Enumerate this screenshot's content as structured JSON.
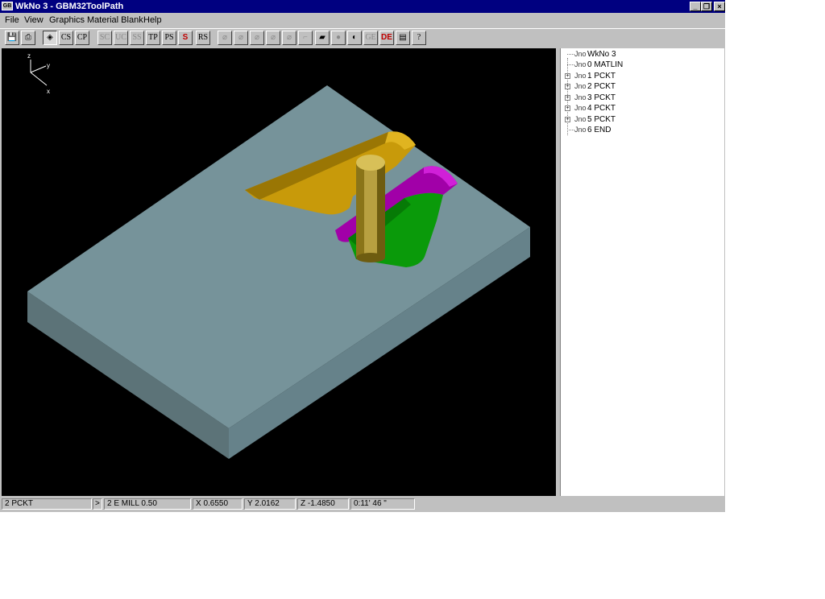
{
  "window": {
    "title": "WkNo 3 - GBM32ToolPath",
    "app_icon": "GB"
  },
  "caption_buttons": {
    "minimize": "_",
    "restore": "❐",
    "close": "×"
  },
  "menu": [
    {
      "label": "File"
    },
    {
      "label": "View"
    },
    {
      "label": "Graphics"
    },
    {
      "label": "Material Blank"
    },
    {
      "label": "Help"
    }
  ],
  "toolbar": {
    "buttons": [
      {
        "label": "💾",
        "icon": "save-icon"
      },
      {
        "label": "⎙",
        "icon": "print-icon"
      },
      {
        "label": "◈",
        "icon": "solid-view-icon"
      },
      {
        "label": "CS"
      },
      {
        "label": "CP"
      },
      {
        "label": "SC"
      },
      {
        "label": "UC"
      },
      {
        "label": "SS"
      },
      {
        "label": "TP"
      },
      {
        "label": "PS"
      },
      {
        "label": "S"
      },
      {
        "label": "RS"
      },
      {
        "label": "⌀",
        "icon": "view-iso-icon"
      },
      {
        "label": "⌀",
        "icon": "view-top-icon"
      },
      {
        "label": "⌀",
        "icon": "view-front-icon"
      },
      {
        "label": "⌀",
        "icon": "view-side-icon"
      },
      {
        "label": "⌀",
        "icon": "view-rotate-icon"
      },
      {
        "label": "⌐",
        "icon": "axis-icon"
      },
      {
        "label": "▰",
        "icon": "block-icon"
      },
      {
        "label": "●",
        "icon": "sphere-icon"
      },
      {
        "label": "◐",
        "icon": "shade-icon"
      },
      {
        "label": "GE"
      },
      {
        "label": "DE"
      },
      {
        "label": "▤",
        "icon": "list-icon"
      },
      {
        "label": "?",
        "icon": "help-icon"
      }
    ]
  },
  "axes": {
    "z": "z",
    "y": "y",
    "x": "x"
  },
  "tree": {
    "nodes": [
      {
        "label": "WkNo 3",
        "icon": "Jno",
        "expandable": false
      },
      {
        "label": "0 MATLIN",
        "icon": "Jno",
        "expandable": false
      },
      {
        "label": "1 PCKT",
        "icon": "Jno",
        "expandable": true
      },
      {
        "label": "2 PCKT",
        "icon": "Jno",
        "expandable": true
      },
      {
        "label": "3 PCKT",
        "icon": "Jno",
        "expandable": true
      },
      {
        "label": "4 PCKT",
        "icon": "Jno",
        "expandable": true
      },
      {
        "label": "5 PCKT",
        "icon": "Jno",
        "expandable": true
      },
      {
        "label": "6 END",
        "icon": "Jno",
        "expandable": false
      }
    ]
  },
  "status": {
    "operation": "2 PCKT",
    "arrow": ">",
    "tool": "2 E MILL 0.50",
    "x": "X 0.6550",
    "y": "Y 2.0162",
    "z": "Z -1.4850",
    "time": "0:11' 46 \""
  },
  "colors": {
    "stock_top": "#76939a",
    "stock_side_left": "#5c7378",
    "stock_side_right": "#66828a",
    "pocket_orange": "#c89a0a",
    "pocket_purple": "#a100a8",
    "pocket_green": "#0a9a0a",
    "tool_gold": "#b8a040"
  }
}
